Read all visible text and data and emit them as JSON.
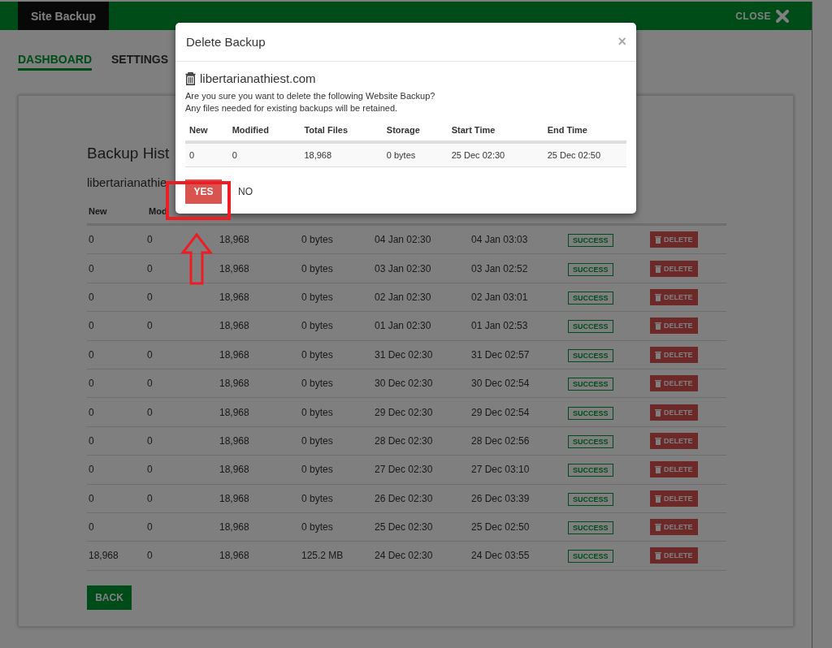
{
  "header": {
    "title": "Site Backup",
    "close": "CLOSE"
  },
  "tabs": [
    {
      "label": "DASHBOARD",
      "selected": true
    },
    {
      "label": "SETTINGS",
      "selected": false
    }
  ],
  "history": {
    "title": "Backup Hist",
    "site": "libertarianathie",
    "columns": [
      "New",
      "Mod"
    ],
    "rows": [
      {
        "new": "0",
        "modified": "0",
        "total_files": "18,968",
        "storage": "0 bytes",
        "start": "04 Jan 02:30",
        "end": "04 Jan 03:03",
        "status": "SUCCESS",
        "action": "DELETE"
      },
      {
        "new": "0",
        "modified": "0",
        "total_files": "18,968",
        "storage": "0 bytes",
        "start": "03 Jan 02:30",
        "end": "03 Jan 02:52",
        "status": "SUCCESS",
        "action": "DELETE"
      },
      {
        "new": "0",
        "modified": "0",
        "total_files": "18,968",
        "storage": "0 bytes",
        "start": "02 Jan 02:30",
        "end": "02 Jan 03:01",
        "status": "SUCCESS",
        "action": "DELETE"
      },
      {
        "new": "0",
        "modified": "0",
        "total_files": "18,968",
        "storage": "0 bytes",
        "start": "01 Jan 02:30",
        "end": "01 Jan 02:53",
        "status": "SUCCESS",
        "action": "DELETE"
      },
      {
        "new": "0",
        "modified": "0",
        "total_files": "18,968",
        "storage": "0 bytes",
        "start": "31 Dec 02:30",
        "end": "31 Dec 02:57",
        "status": "SUCCESS",
        "action": "DELETE"
      },
      {
        "new": "0",
        "modified": "0",
        "total_files": "18,968",
        "storage": "0 bytes",
        "start": "30 Dec 02:30",
        "end": "30 Dec 02:54",
        "status": "SUCCESS",
        "action": "DELETE"
      },
      {
        "new": "0",
        "modified": "0",
        "total_files": "18,968",
        "storage": "0 bytes",
        "start": "29 Dec 02:30",
        "end": "29 Dec 02:54",
        "status": "SUCCESS",
        "action": "DELETE"
      },
      {
        "new": "0",
        "modified": "0",
        "total_files": "18,968",
        "storage": "0 bytes",
        "start": "28 Dec 02:30",
        "end": "28 Dec 02:56",
        "status": "SUCCESS",
        "action": "DELETE"
      },
      {
        "new": "0",
        "modified": "0",
        "total_files": "18,968",
        "storage": "0 bytes",
        "start": "27 Dec 02:30",
        "end": "27 Dec 03:10",
        "status": "SUCCESS",
        "action": "DELETE"
      },
      {
        "new": "0",
        "modified": "0",
        "total_files": "18,968",
        "storage": "0 bytes",
        "start": "26 Dec 02:30",
        "end": "26 Dec 03:39",
        "status": "SUCCESS",
        "action": "DELETE"
      },
      {
        "new": "0",
        "modified": "0",
        "total_files": "18,968",
        "storage": "0 bytes",
        "start": "25 Dec 02:30",
        "end": "25 Dec 02:50",
        "status": "SUCCESS",
        "action": "DELETE"
      },
      {
        "new": "18,968",
        "modified": "0",
        "total_files": "18,968",
        "storage": "125.2 MB",
        "start": "24 Dec 02:30",
        "end": "24 Dec 03:55",
        "status": "SUCCESS",
        "action": "DELETE"
      }
    ],
    "back": "BACK"
  },
  "modal": {
    "title": "Delete Backup",
    "close": "×",
    "site": "libertarianathiest.com",
    "message": [
      "Are you sure you want to delete the following Website Backup?",
      "Any files needed for existing backups will be retained."
    ],
    "columns": [
      "New",
      "Modified",
      "Total Files",
      "Storage",
      "Start Time",
      "End Time"
    ],
    "row": [
      "0",
      "0",
      "18,968",
      "0 bytes",
      "25 Dec 02:30",
      "25 Dec 02:50"
    ],
    "yes": "YES",
    "no": "NO"
  }
}
